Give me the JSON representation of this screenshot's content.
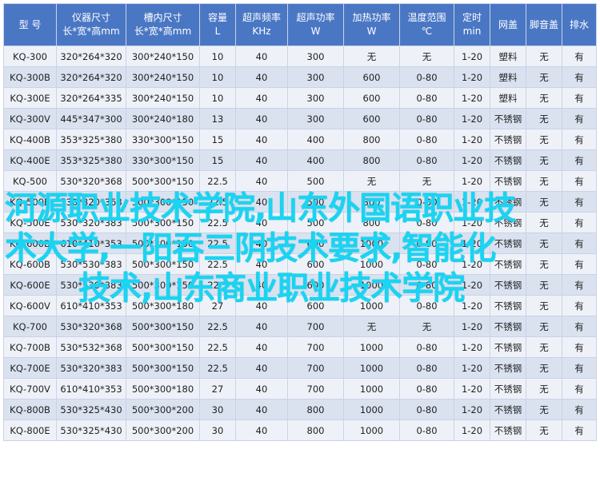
{
  "headers": [
    {
      "line1": "型 号",
      "line2": ""
    },
    {
      "line1": "仪器尺寸",
      "line2": "长*宽*高mm"
    },
    {
      "line1": "槽内尺寸",
      "line2": "长*宽*高mm"
    },
    {
      "line1": "容量",
      "line2": "L"
    },
    {
      "line1": "超声频率",
      "line2": "KHz"
    },
    {
      "line1": "超声功率",
      "line2": "W"
    },
    {
      "line1": "加热功率",
      "line2": "W"
    },
    {
      "line1": "温度范围",
      "line2": "℃"
    },
    {
      "line1": "定时",
      "line2": "min"
    },
    {
      "line1": "网盖",
      "line2": ""
    },
    {
      "line1": "脚音盖",
      "line2": ""
    },
    {
      "line1": "排水",
      "line2": ""
    }
  ],
  "rows": [
    [
      "KQ-300",
      "320*264*320",
      "300*240*150",
      "10",
      "40",
      "300",
      "无",
      "无",
      "1-20",
      "塑料",
      "无",
      "有"
    ],
    [
      "KQ-300B",
      "320*264*320",
      "300*240*150",
      "10",
      "40",
      "300",
      "600",
      "0-80",
      "1-20",
      "塑料",
      "无",
      "有"
    ],
    [
      "KQ-300E",
      "320*264*335",
      "300*240*150",
      "10",
      "40",
      "300",
      "600",
      "0-80",
      "1-20",
      "塑料",
      "无",
      "有"
    ],
    [
      "KQ-300V",
      "445*347*300",
      "300*240*180",
      "13",
      "40",
      "300",
      "600",
      "0-80",
      "1-20",
      "不锈钢",
      "无",
      "有"
    ],
    [
      "KQ-400B",
      "353*325*380",
      "330*300*150",
      "15",
      "40",
      "400",
      "800",
      "0-80",
      "1-20",
      "不锈钢",
      "无",
      "有"
    ],
    [
      "KQ-400E",
      "353*325*380",
      "330*300*150",
      "15",
      "40",
      "400",
      "800",
      "0-80",
      "1-20",
      "不锈钢",
      "无",
      "有"
    ],
    [
      "KQ-500",
      "530*320*368",
      "500*300*150",
      "22.5",
      "40",
      "500",
      "无",
      "无",
      "1-20",
      "不锈钢",
      "无",
      "有"
    ],
    [
      "KQ-500B",
      "530*320*368",
      "500*300*150",
      "22.5",
      "40",
      "500",
      "800",
      "0-80",
      "1-20",
      "不锈钢",
      "无",
      "有"
    ],
    [
      "KQ-500E",
      "530*320*383",
      "500*300*150",
      "22.5",
      "40",
      "500",
      "800",
      "0-80",
      "1-20",
      "不锈钢",
      "无",
      "有"
    ],
    [
      "KQ-600B",
      "610*410*353",
      "500*300*150",
      "22.5",
      "40",
      "600",
      "1000",
      "0-80",
      "1-20",
      "不锈钢",
      "无",
      "有"
    ],
    [
      "KQ-600B",
      "530*530*383",
      "500*300*150",
      "22.5",
      "40",
      "600",
      "1000",
      "0-80",
      "1-20",
      "不锈钢",
      "无",
      "有"
    ],
    [
      "KQ-600E",
      "530*530*383",
      "500*300*150",
      "22.5",
      "40",
      "600",
      "1000",
      "0-80",
      "1-20",
      "不锈钢",
      "无",
      "有"
    ],
    [
      "KQ-600V",
      "610*410*353",
      "500*300*180",
      "27",
      "40",
      "600",
      "1000",
      "0-80",
      "1-20",
      "不锈钢",
      "无",
      "有"
    ],
    [
      "KQ-700",
      "530*320*368",
      "500*300*150",
      "22.5",
      "40",
      "700",
      "无",
      "无",
      "1-20",
      "不锈钢",
      "无",
      "有"
    ],
    [
      "KQ-700B",
      "530*532*368",
      "500*300*150",
      "22.5",
      "40",
      "700",
      "1000",
      "0-80",
      "1-20",
      "不锈钢",
      "无",
      "有"
    ],
    [
      "KQ-700E",
      "530*320*383",
      "500*300*150",
      "22.5",
      "40",
      "700",
      "1000",
      "0-80",
      "1-20",
      "不锈钢",
      "无",
      "有"
    ],
    [
      "KQ-700V",
      "610*410*353",
      "500*300*180",
      "27",
      "40",
      "700",
      "1000",
      "0-80",
      "1-20",
      "不锈钢",
      "无",
      "有"
    ],
    [
      "KQ-800B",
      "530*325*430",
      "500*300*200",
      "30",
      "40",
      "800",
      "1000",
      "0-80",
      "1-20",
      "不锈钢",
      "无",
      "有"
    ],
    [
      "KQ-800E",
      "530*325*430",
      "500*300*200",
      "30",
      "40",
      "800",
      "1000",
      "0-80",
      "1-20",
      "不锈钢",
      "无",
      "有"
    ]
  ],
  "watermark": {
    "line1": "河源职业技术学院,山东外国语职业技",
    "line2": "术大学,一阳吞三阴技术要求,智能化",
    "line3": "技术,山东商业职业技术学院"
  }
}
